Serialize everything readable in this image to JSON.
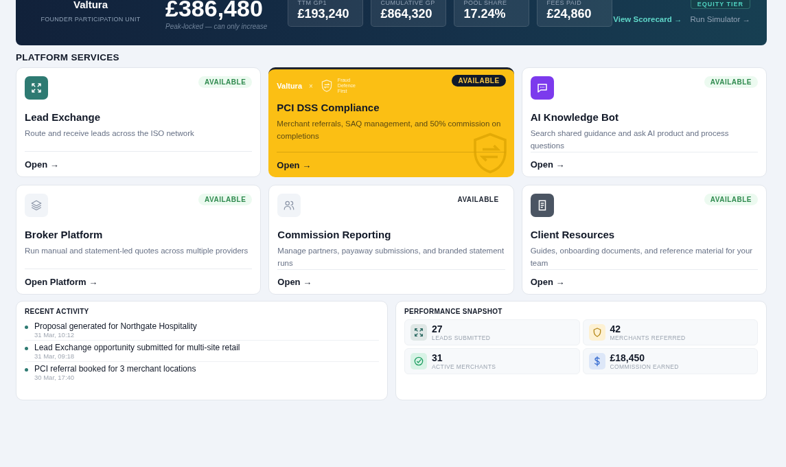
{
  "banner": {
    "brand": "Valtura",
    "unit_label": "FOUNDER PARTICIPATION UNIT",
    "value": "£386,480",
    "value_note": "Peak-locked — can only increase",
    "stats": [
      {
        "label": "TTM GP1",
        "value": "£193,240"
      },
      {
        "label": "CUMULATIVE GP",
        "value": "£864,320"
      },
      {
        "label": "POOL SHARE",
        "value": "17.24%"
      },
      {
        "label": "FEES PAID",
        "value": "£24,860"
      }
    ],
    "tier_badge": "EQUITY TIER",
    "links": [
      {
        "label": "View Scorecard →",
        "primary": true
      },
      {
        "label": "Run Simulator →",
        "primary": false
      }
    ]
  },
  "section_title": "PLATFORM SERVICES",
  "services": [
    {
      "kind": "standard",
      "title": "Lead Exchange",
      "description": "Route and receive leads across the ISO network",
      "badge": "AVAILABLE",
      "badge_pill": true,
      "action": "Open →"
    },
    {
      "kind": "featured",
      "partner": {
        "brand": "Valtura",
        "separator": "×",
        "partner_name": "Fraud Defence First"
      },
      "title": "PCI DSS Compliance",
      "description": "Merchant referrals, SAQ management, and 50% commission on completions",
      "badge": "AVAILABLE",
      "badge_pill": true,
      "action": "Open →"
    },
    {
      "kind": "standard",
      "title": "AI Knowledge Bot",
      "description": "Search shared guidance and ask AI product and process questions",
      "badge": "AVAILABLE",
      "badge_pill": true,
      "action": "Open →"
    },
    {
      "kind": "standard",
      "title": "Broker Platform",
      "description": "Run manual and statement-led quotes across multiple providers",
      "badge": "AVAILABLE",
      "badge_pill": true,
      "action": "Open Platform →"
    },
    {
      "kind": "standard",
      "title": "Commission Reporting",
      "description": "Manage partners, payaway submissions, and branded statement runs",
      "badge": "AVAILABLE",
      "badge_pill": false,
      "action": "Open →"
    },
    {
      "kind": "standard",
      "title": "Client Resources",
      "description": "Guides, onboarding documents, and reference material for your team",
      "badge": "AVAILABLE",
      "badge_pill": true,
      "action": "Open →"
    }
  ],
  "recent_activity": {
    "title": "RECENT ACTIVITY",
    "items": [
      {
        "text": "Proposal generated for Northgate Hospitality",
        "time": "31 Mar, 10:12"
      },
      {
        "text": "Lead Exchange opportunity submitted for multi-site retail",
        "time": "31 Mar, 09:18"
      },
      {
        "text": "PCI referral booked for 3 merchant locations",
        "time": "30 Mar, 17:40"
      }
    ]
  },
  "performance": {
    "title": "PERFORMANCE SNAPSHOT",
    "metrics": [
      {
        "value": "27",
        "label": "LEADS SUBMITTED"
      },
      {
        "value": "42",
        "label": "MERCHANTS REFERRED"
      },
      {
        "value": "31",
        "label": "ACTIVE MERCHANTS"
      },
      {
        "value": "£18,450",
        "label": "COMMISSION EARNED"
      }
    ]
  }
}
